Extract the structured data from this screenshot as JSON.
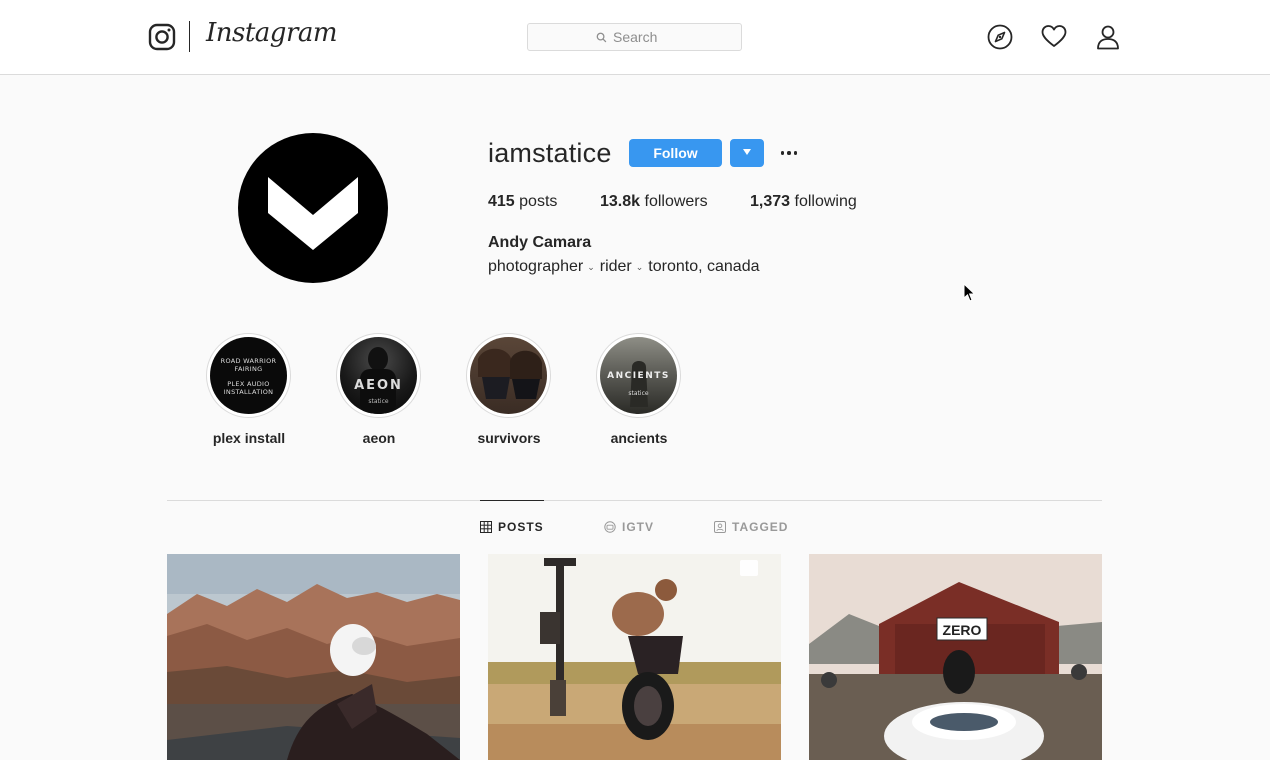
{
  "header": {
    "logo_icon": "instagram-camera-icon",
    "wordmark": "Instagram",
    "search": {
      "placeholder": "Search",
      "icon": "search-icon"
    },
    "icons": [
      "compass-icon",
      "heart-icon",
      "person-icon"
    ]
  },
  "profile": {
    "username": "iamstatice",
    "avatar_icon": "chevron-down-icon",
    "follow_label": "Follow",
    "dropdown_icon": "caret-down-icon",
    "more_icon": "more-options-icon",
    "stats": {
      "posts_count": "415",
      "posts_label": "posts",
      "followers_count": "13.8k",
      "followers_label": "followers",
      "following_count": "1,373",
      "following_label": "following"
    },
    "full_name": "Andy Camara",
    "bio": [
      "photographer",
      "rider",
      "toronto, canada"
    ]
  },
  "highlights": [
    {
      "label": "plex install",
      "cover_lines": [
        "ROAD WARRIOR",
        "FAIRING",
        "PLEX AUDIO",
        "INSTALLATION"
      ]
    },
    {
      "label": "aeon",
      "cover_lines": [
        "AEON",
        "statice"
      ]
    },
    {
      "label": "survivors"
    },
    {
      "label": "ancients",
      "cover_lines": [
        "ANCIENTS",
        "statice"
      ]
    }
  ],
  "tabs": [
    {
      "label": "POSTS",
      "icon": "grid-icon",
      "active": true
    },
    {
      "label": "IGTV",
      "icon": "igtv-icon",
      "active": false
    },
    {
      "label": "TAGGED",
      "icon": "tagged-icon",
      "active": false
    }
  ],
  "posts": [
    {
      "subject": "rider-on-motorcycle-in-badlands"
    },
    {
      "subject": "shirtless-rider-wheelie-dirt-bike",
      "badge_icon": "carousel-icon"
    },
    {
      "subject": "zero-barn-porsche-gathering",
      "sign": "ZERO"
    }
  ],
  "colors": {
    "accent": "#3897f0",
    "text": "#262626",
    "muted": "#8e8e8e",
    "border": "#dbdbdb"
  }
}
